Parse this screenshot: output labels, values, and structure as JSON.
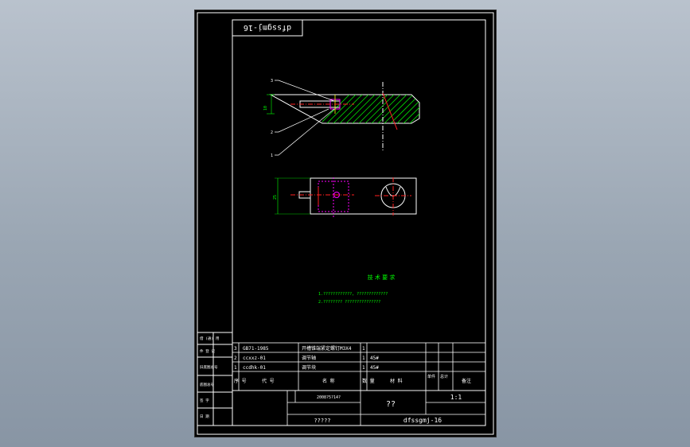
{
  "drawing": {
    "title_stamp": "dfssgmj-16",
    "colors": {
      "background": "#000000",
      "frame": "#ffffff",
      "hatch": "#00e000",
      "centerline": "#ff2020",
      "hidden": "#ff00ff",
      "notes": "#00ff00",
      "dimension": "#00ff00"
    },
    "leaders": [
      "3",
      "2",
      "1"
    ],
    "tech_req": {
      "title": "技 术 要 求",
      "line1": "1.????????????, ?????????????",
      "line2": "2.???????? ???????????????"
    },
    "dimensions": {
      "height_label": "25",
      "thickness_label": "10"
    }
  },
  "bom": {
    "rows": [
      {
        "no": "3",
        "code": "GB71-1985",
        "name": "开槽锥端紧定螺钉M3X4",
        "qty": "1",
        "material": "",
        "weight": ""
      },
      {
        "no": "2",
        "code": "ccxxz-01",
        "name": "调节轴",
        "qty": "1",
        "material": "45#",
        "weight": ""
      },
      {
        "no": "1",
        "code": "ccdhk-01",
        "name": "调节块",
        "qty": "1",
        "material": "45#",
        "weight": ""
      }
    ],
    "header": {
      "no": "序\n号",
      "code": "代 号",
      "name": "名 称",
      "qty": "数\n量",
      "material": "材 料",
      "unit_weight": "单件",
      "total_weight": "总计",
      "remark": "备注"
    }
  },
  "title_block": {
    "designer": "",
    "date": "2008?5?14?",
    "part_name": "??",
    "scale": "1:1",
    "company": "?????",
    "drawing_no": "dfssgmj-16"
  },
  "side_column": {
    "labels": [
      "借 (通) 用",
      "件 登 记",
      "旧底图总号",
      "底图总号",
      "签 字",
      "日 期"
    ]
  }
}
